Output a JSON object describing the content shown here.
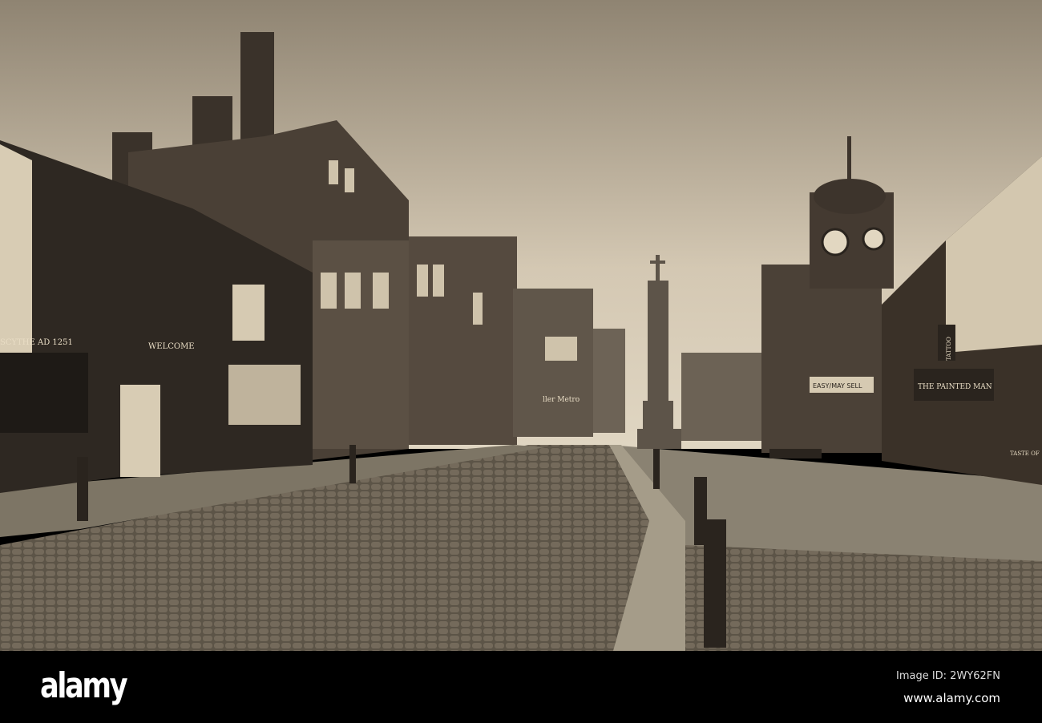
{
  "watermark": {
    "logo": "alamy",
    "image_id": "Image ID: 2WY62FN",
    "url": "www.alamy.com"
  },
  "signs": {
    "pub": "SCYTHE AD 1251",
    "welcome": "WELCOME",
    "tattoo": "TATTOO",
    "painted_man": "THE PAINTED MAN",
    "easy_sell": "EASY/MAY SELL",
    "taste": "TASTE OF",
    "shop": "ller Metro"
  },
  "colors": {
    "sky": "#c9bda8",
    "stone": "#6b6255",
    "dark": "#2b2620"
  }
}
